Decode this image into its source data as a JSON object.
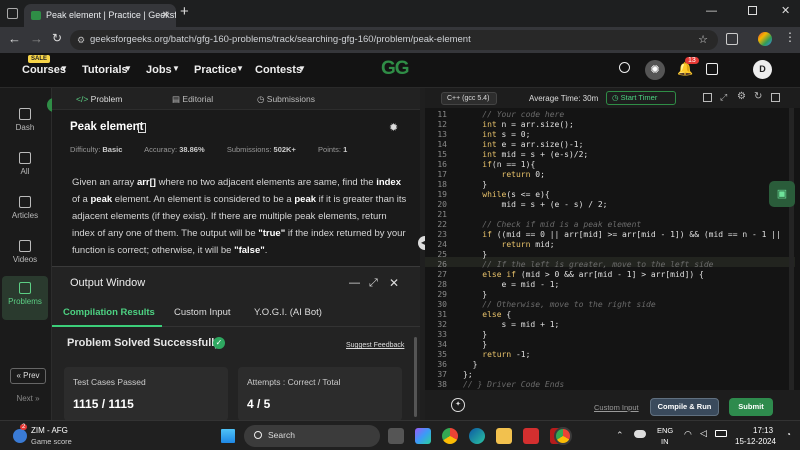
{
  "browser": {
    "tab_title": "Peak element | Practice | GeeksforGeeks",
    "new_tab": "+",
    "url": "geeksforgeeks.org/batch/gfg-160-problems/track/searching-gfg-160/problem/peak-element"
  },
  "nav": {
    "sale_badge": "SALE",
    "items": [
      "Courses",
      "Tutorials",
      "Jobs",
      "Practice",
      "Contests"
    ],
    "notifications": "13",
    "avatar": "D",
    "logo_text": "GG"
  },
  "sidebar": {
    "items": [
      {
        "label": "Dash",
        "icon": "dashboard-icon"
      },
      {
        "label": "All",
        "icon": "grid-icon"
      },
      {
        "label": "Articles",
        "icon": "book-icon"
      },
      {
        "label": "Videos",
        "icon": "video-icon"
      },
      {
        "label": "Problems",
        "icon": "code-icon"
      }
    ],
    "prev": "« Prev",
    "next": "Next »"
  },
  "problem": {
    "tabs": [
      "Problem",
      "Editorial",
      "Submissions"
    ],
    "title": "Peak element",
    "difficulty_label": "Difficulty:",
    "difficulty": "Basic",
    "accuracy_label": "Accuracy:",
    "accuracy": "38.86%",
    "submissions_label": "Submissions:",
    "submissions": "502K+",
    "points_label": "Points:",
    "points": "1",
    "description": {
      "p1": "Given an array ",
      "b1": "arr[]",
      "p2": " where no two adjacent elements are same, find the ",
      "b2": "index",
      "p3": " of a ",
      "b3": "peak",
      "p4": " element. An element is considered to be a ",
      "b4": "peak",
      "p5": " if it is greater than its adjacent elements (if they exist). If there are multiple peak elements, return index of any one of them. The output will be ",
      "b5": "\"true\"",
      "p6": " if the index returned by your function is correct; otherwise, it will be ",
      "b6": "\"false\"",
      "p7": "."
    }
  },
  "output": {
    "title": "Output Window",
    "tabs": [
      "Compilation Results",
      "Custom Input",
      "Y.O.G.I. (AI Bot)"
    ],
    "status": "Problem Solved Successfully",
    "feedback": "Suggest Feedback",
    "cards": [
      {
        "label": "Test Cases Passed",
        "value": "1115 / 1115"
      },
      {
        "label": "Attempts : Correct / Total",
        "value": "4 / 5"
      }
    ]
  },
  "editor": {
    "language": "C++ (gcc 5.4)",
    "avg_time_label": "Average Time:",
    "avg_time": "30m",
    "start_timer": "Start Timer",
    "lines": [
      {
        "n": "11",
        "t": "    // Your code here"
      },
      {
        "n": "12",
        "t": "    int n = arr.size();"
      },
      {
        "n": "13",
        "t": "    int s = 0;"
      },
      {
        "n": "14",
        "t": "    int e = arr.size()-1;"
      },
      {
        "n": "15",
        "t": "    int mid = s + (e-s)/2;"
      },
      {
        "n": "16",
        "t": "    if(n == 1){"
      },
      {
        "n": "17",
        "t": "        return 0;"
      },
      {
        "n": "18",
        "t": "    }"
      },
      {
        "n": "19",
        "t": "    while(s <= e){"
      },
      {
        "n": "20",
        "t": "        mid = s + (e - s) / 2;"
      },
      {
        "n": "21",
        "t": ""
      },
      {
        "n": "22",
        "t": "    // Check if mid is a peak element"
      },
      {
        "n": "23",
        "t": "    if ((mid == 0 || arr[mid] >= arr[mid - 1]) && (mid == n - 1 ||"
      },
      {
        "n": "24",
        "t": "        return mid;"
      },
      {
        "n": "25",
        "t": "    }"
      },
      {
        "n": "26",
        "t": "    // If the left is greater, move to the left side"
      },
      {
        "n": "27",
        "t": "    else if (mid > 0 && arr[mid - 1] > arr[mid]) {"
      },
      {
        "n": "28",
        "t": "        e = mid - 1;"
      },
      {
        "n": "29",
        "t": "    }"
      },
      {
        "n": "30",
        "t": "    // Otherwise, move to the right side"
      },
      {
        "n": "31",
        "t": "    else {"
      },
      {
        "n": "32",
        "t": "        s = mid + 1;"
      },
      {
        "n": "33",
        "t": "    }"
      },
      {
        "n": "34",
        "t": "    }"
      },
      {
        "n": "35",
        "t": "    return -1;"
      },
      {
        "n": "36",
        "t": "  }"
      },
      {
        "n": "37",
        "t": "};"
      },
      {
        "n": "38",
        "t": "// } Driver Code Ends"
      }
    ],
    "custom_input": "Custom Input",
    "compile_run": "Compile & Run",
    "submit": "Submit"
  },
  "taskbar": {
    "weather_title": "ZIM - AFG",
    "weather_sub": "Game score",
    "weather_badge": "2",
    "search": "Search",
    "lang_top": "ENG",
    "lang_bottom": "IN",
    "time": "17:13",
    "date": "15-12-2024"
  },
  "colors": {
    "accent_green": "#2f8d46",
    "submit_green": "#2e8b4d",
    "compile_blue": "#3a4a5c",
    "success": "#3ccf7a"
  }
}
